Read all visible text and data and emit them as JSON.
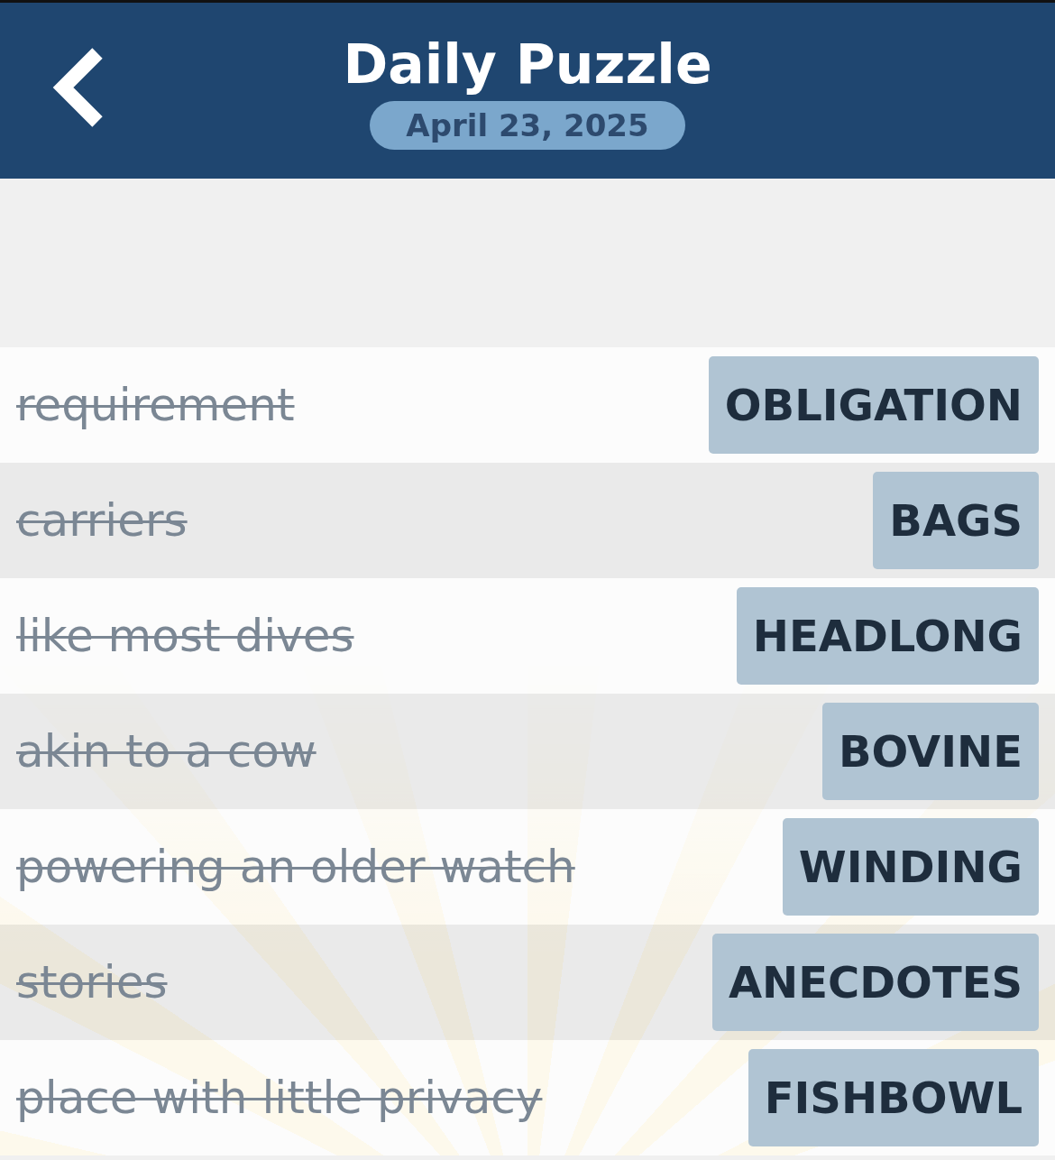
{
  "header": {
    "title": "Daily Puzzle",
    "date": "April 23, 2025"
  },
  "clues": [
    {
      "clue": "requirement",
      "answer": "OBLIGATION",
      "solved": true
    },
    {
      "clue": "carriers",
      "answer": "BAGS",
      "solved": true
    },
    {
      "clue": "like most dives",
      "answer": "HEADLONG",
      "solved": true
    },
    {
      "clue": "akin to a cow",
      "answer": "BOVINE",
      "solved": true
    },
    {
      "clue": "powering an older watch",
      "answer": "WINDING",
      "solved": true
    },
    {
      "clue": "stories",
      "answer": "ANECDOTES",
      "solved": true
    },
    {
      "clue": "place with little privacy",
      "answer": "FISHBOWL",
      "solved": true
    }
  ]
}
